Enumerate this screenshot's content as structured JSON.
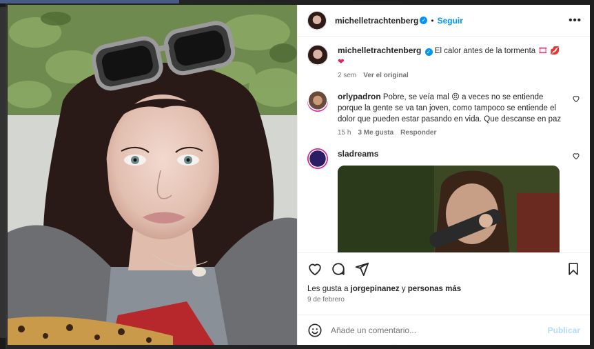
{
  "post": {
    "author": "michelletrachtenberg",
    "follow_label": "Seguir",
    "dot": "•",
    "more": "•••",
    "verified_mark": "✓",
    "caption": "El calor antes de la tormenta",
    "caption_emoji": "🎞 💋 ❤",
    "caption_age": "2 sem",
    "see_original": "Ver el original"
  },
  "comments": [
    {
      "user": "orlypadron",
      "text": "Pobre, se veía mal 😣  a veces no se entiende porque la gente se va tan joven, como tampoco se entiende el dolor que pueden estar pasando en vida. Que descanse en paz",
      "age": "15 h",
      "likes": "3 Me gusta",
      "reply": "Responder"
    },
    {
      "user": "sladreams",
      "text": ""
    }
  ],
  "actions": {
    "likes_prefix": "Les gusta a",
    "liked_by": "jorgepinanez",
    "likes_mid": "y",
    "likes_rest": "personas más",
    "date": "9 de febrero"
  },
  "composer": {
    "emoji": "☺",
    "placeholder": "Añade un comentario...",
    "publish": "Publicar"
  },
  "icons": {
    "like": "heart-icon",
    "comment": "comment-icon",
    "share": "share-icon",
    "save": "bookmark-icon",
    "emoji": "emoji-icon",
    "comment_like": "heart-icon"
  }
}
